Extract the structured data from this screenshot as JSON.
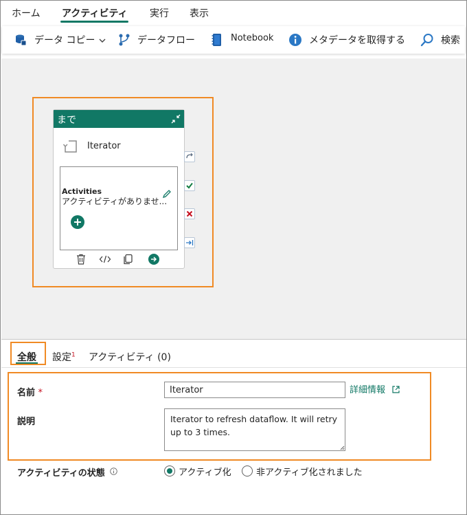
{
  "menu": {
    "tabs": [
      {
        "label": "ホーム"
      },
      {
        "label": "アクティビティ"
      },
      {
        "label": "実行"
      },
      {
        "label": "表示"
      }
    ]
  },
  "toolbar": {
    "copy_data": "データ コピー",
    "dataflow": "データフロー",
    "notebook": "Notebook",
    "get_metadata": "メタデータを取得する",
    "search": "検索"
  },
  "activity": {
    "header": "まで",
    "name": "Iterator",
    "activities_title": "Activities",
    "no_activities": "アクティビティがありませ..."
  },
  "panel": {
    "tabs": [
      {
        "label": "全般"
      },
      {
        "label": "設定",
        "badge": "1"
      },
      {
        "label": "アクティビティ (0)"
      }
    ],
    "name_label": "名前",
    "required_mark": "*",
    "name_value": "Iterator",
    "learn_more": "詳細情報",
    "desc_label": "説明",
    "desc_value": "Iterator to refresh dataflow. It will retry up to 3 times.",
    "state_label": "アクティビティの状態",
    "state_active": "アクティブ化",
    "state_inactive": "非アクティブ化されました"
  },
  "colors": {
    "accent": "#117865",
    "highlight": "#f08a24",
    "error": "#c50f1f"
  }
}
